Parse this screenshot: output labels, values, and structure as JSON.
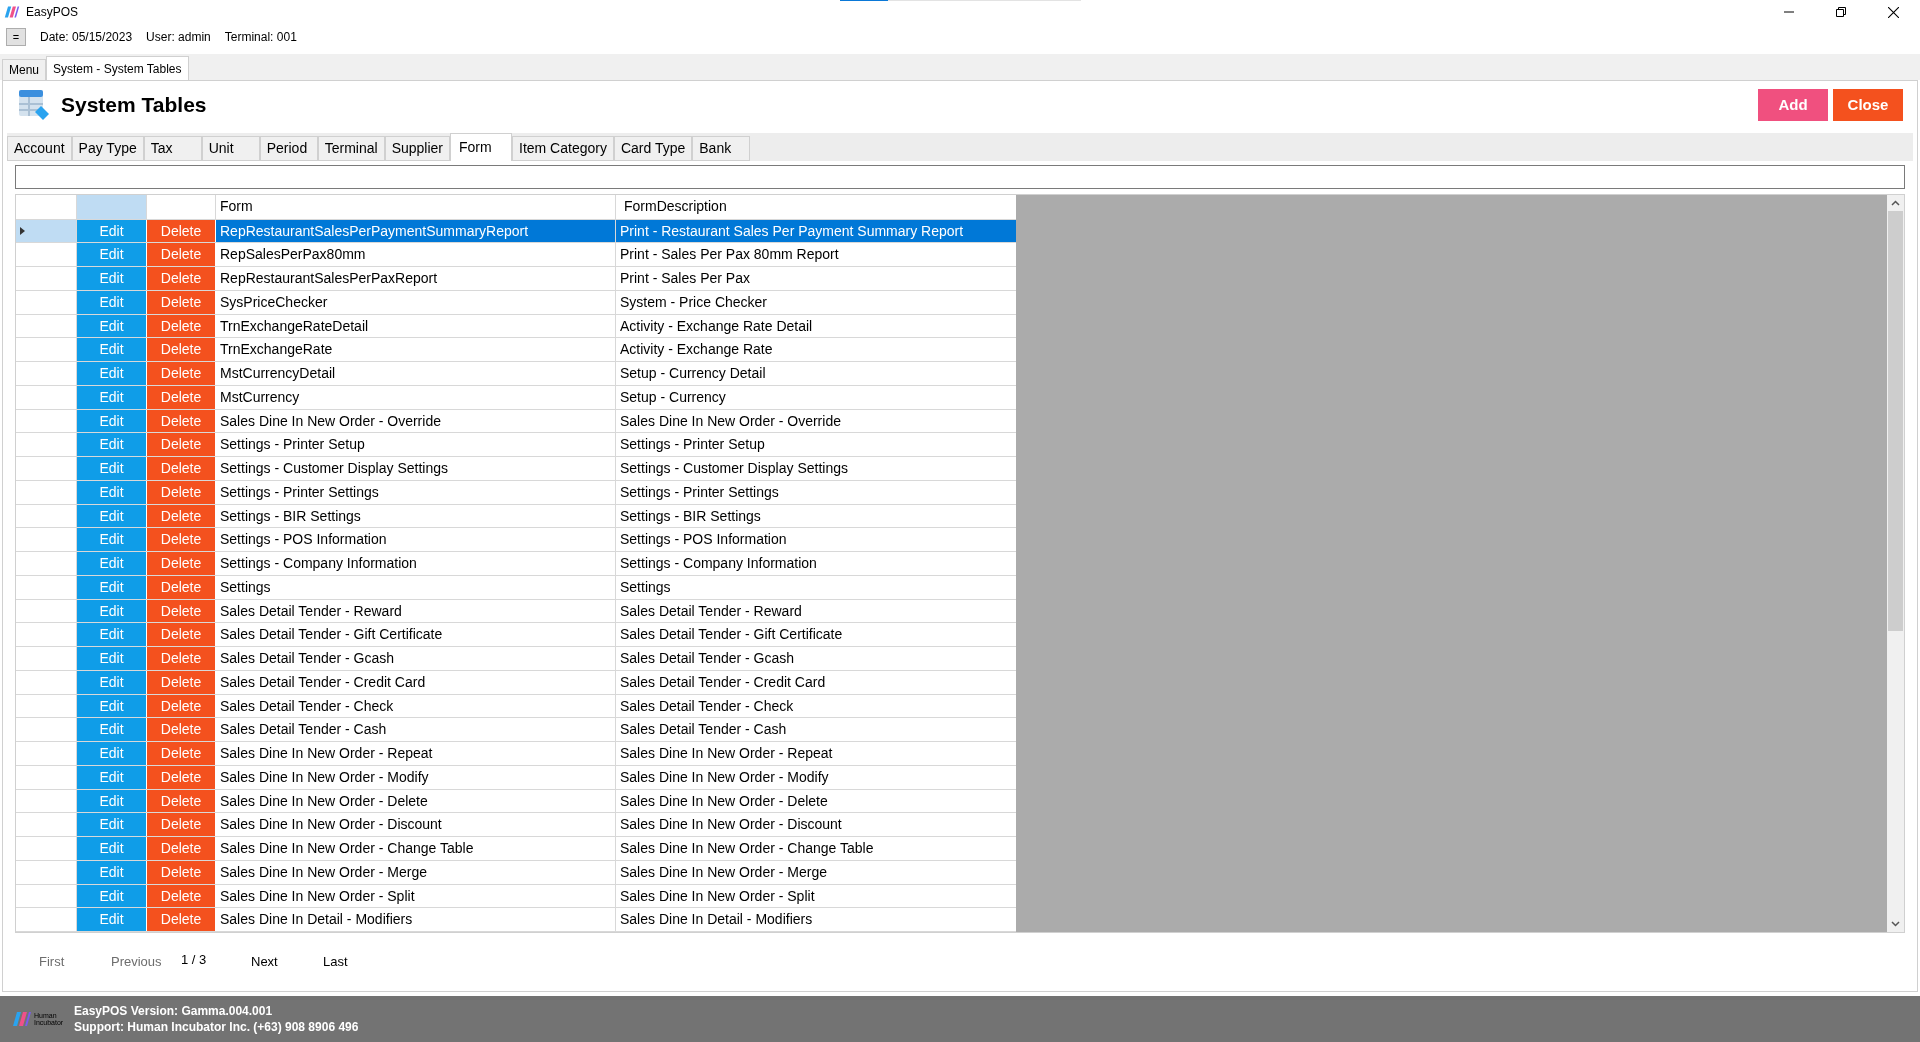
{
  "window": {
    "title": "EasyPOS"
  },
  "loading_bar": {
    "level": 0.2
  },
  "info_bar": {
    "menu_button": "=",
    "date": "Date: 05/15/2023",
    "user": "User: admin",
    "terminal": "Terminal: 001"
  },
  "doc_tabs": [
    {
      "label": "Menu",
      "selected": false
    },
    {
      "label": "System - System Tables",
      "selected": true
    }
  ],
  "page": {
    "title": "System Tables",
    "buttons": [
      {
        "label": "Add",
        "kind": "add"
      },
      {
        "label": "Close",
        "kind": "close"
      }
    ]
  },
  "table_tabs": [
    {
      "label": "Account",
      "selected": false
    },
    {
      "label": "Pay Type",
      "selected": false
    },
    {
      "label": "Tax",
      "selected": false
    },
    {
      "label": "Unit",
      "selected": false
    },
    {
      "label": "Period",
      "selected": false
    },
    {
      "label": "Terminal",
      "selected": false
    },
    {
      "label": "Supplier",
      "selected": false
    },
    {
      "label": "Form",
      "selected": true
    },
    {
      "label": "Item Category",
      "selected": false
    },
    {
      "label": "Card Type",
      "selected": false
    },
    {
      "label": "Bank",
      "selected": false
    }
  ],
  "table": {
    "columns": [
      "Form",
      "FormDescription"
    ],
    "rows": [
      {
        "edit": "Edit",
        "delete": "Delete",
        "form": "RepRestaurantSalesPerPaymentSummaryReport",
        "description": "Print - Restaurant Sales Per Payment Summary Report",
        "selected": true
      },
      {
        "edit": "Edit",
        "delete": "Delete",
        "form": "RepSalesPerPax80mm",
        "description": "Print - Sales Per Pax 80mm Report",
        "selected": false
      },
      {
        "edit": "Edit",
        "delete": "Delete",
        "form": "RepRestaurantSalesPerPaxReport",
        "description": "Print - Sales Per Pax",
        "selected": false
      },
      {
        "edit": "Edit",
        "delete": "Delete",
        "form": "SysPriceChecker",
        "description": "System - Price Checker",
        "selected": false
      },
      {
        "edit": "Edit",
        "delete": "Delete",
        "form": "TrnExchangeRateDetail",
        "description": "Activity - Exchange Rate Detail",
        "selected": false
      },
      {
        "edit": "Edit",
        "delete": "Delete",
        "form": "TrnExchangeRate",
        "description": "Activity - Exchange Rate",
        "selected": false
      },
      {
        "edit": "Edit",
        "delete": "Delete",
        "form": "MstCurrencyDetail",
        "description": "Setup - Currency Detail",
        "selected": false
      },
      {
        "edit": "Edit",
        "delete": "Delete",
        "form": "MstCurrency",
        "description": "Setup - Currency",
        "selected": false
      },
      {
        "edit": "Edit",
        "delete": "Delete",
        "form": "Sales Dine In New Order - Override",
        "description": "Sales Dine In New Order - Override",
        "selected": false
      },
      {
        "edit": "Edit",
        "delete": "Delete",
        "form": "Settings - Printer Setup",
        "description": "Settings - Printer Setup",
        "selected": false
      },
      {
        "edit": "Edit",
        "delete": "Delete",
        "form": "Settings - Customer Display Settings",
        "description": "Settings - Customer Display Settings",
        "selected": false
      },
      {
        "edit": "Edit",
        "delete": "Delete",
        "form": "Settings - Printer Settings",
        "description": "Settings - Printer Settings",
        "selected": false
      },
      {
        "edit": "Edit",
        "delete": "Delete",
        "form": "Settings - BIR Settings",
        "description": "Settings - BIR Settings",
        "selected": false
      },
      {
        "edit": "Edit",
        "delete": "Delete",
        "form": "Settings - POS Information",
        "description": "Settings - POS Information",
        "selected": false
      },
      {
        "edit": "Edit",
        "delete": "Delete",
        "form": "Settings - Company Information",
        "description": "Settings - Company Information",
        "selected": false
      },
      {
        "edit": "Edit",
        "delete": "Delete",
        "form": "Settings",
        "description": "Settings",
        "selected": false
      },
      {
        "edit": "Edit",
        "delete": "Delete",
        "form": "Sales Detail Tender - Reward",
        "description": "Sales Detail Tender - Reward",
        "selected": false
      },
      {
        "edit": "Edit",
        "delete": "Delete",
        "form": "Sales Detail Tender - Gift Certificate",
        "description": "Sales Detail Tender - Gift Certificate",
        "selected": false
      },
      {
        "edit": "Edit",
        "delete": "Delete",
        "form": "Sales Detail Tender - Gcash",
        "description": "Sales Detail Tender - Gcash",
        "selected": false
      },
      {
        "edit": "Edit",
        "delete": "Delete",
        "form": "Sales Detail Tender - Credit Card",
        "description": "Sales Detail Tender - Credit Card",
        "selected": false
      },
      {
        "edit": "Edit",
        "delete": "Delete",
        "form": "Sales Detail Tender - Check",
        "description": "Sales Detail Tender - Check",
        "selected": false
      },
      {
        "edit": "Edit",
        "delete": "Delete",
        "form": "Sales Detail Tender - Cash",
        "description": "Sales Detail Tender - Cash",
        "selected": false
      },
      {
        "edit": "Edit",
        "delete": "Delete",
        "form": "Sales Dine In New Order - Repeat",
        "description": "Sales Dine In New Order - Repeat",
        "selected": false
      },
      {
        "edit": "Edit",
        "delete": "Delete",
        "form": "Sales Dine In New Order - Modify",
        "description": "Sales Dine In New Order - Modify",
        "selected": false
      },
      {
        "edit": "Edit",
        "delete": "Delete",
        "form": "Sales Dine In New Order - Delete",
        "description": "Sales Dine In New Order - Delete",
        "selected": false
      },
      {
        "edit": "Edit",
        "delete": "Delete",
        "form": "Sales Dine In New Order - Discount",
        "description": "Sales Dine In New Order - Discount",
        "selected": false
      },
      {
        "edit": "Edit",
        "delete": "Delete",
        "form": "Sales Dine In New Order - Change Table",
        "description": "Sales Dine In New Order - Change Table",
        "selected": false
      },
      {
        "edit": "Edit",
        "delete": "Delete",
        "form": "Sales Dine In New Order - Merge",
        "description": "Sales Dine In New Order - Merge",
        "selected": false
      },
      {
        "edit": "Edit",
        "delete": "Delete",
        "form": "Sales Dine In New Order - Split",
        "description": "Sales Dine In New Order - Split",
        "selected": false
      },
      {
        "edit": "Edit",
        "delete": "Delete",
        "form": "Sales Dine In Detail - Modifiers",
        "description": "Sales Dine In Detail - Modifiers",
        "selected": false
      }
    ]
  },
  "pager": [
    {
      "label": "First",
      "kind": "link",
      "disabled": true
    },
    {
      "label": "Previous",
      "kind": "link",
      "disabled": true
    },
    {
      "label": "1 / 3",
      "kind": "page"
    },
    {
      "label": "Next",
      "kind": "link",
      "disabled": false
    },
    {
      "label": "Last",
      "kind": "link",
      "disabled": false
    }
  ],
  "status_bar": {
    "logo_text": "Human Incubator",
    "version": "EasyPOS Version: Gamma.004.001",
    "support": "Support: Human Incubator Inc. (+63) 908 8906 496"
  }
}
